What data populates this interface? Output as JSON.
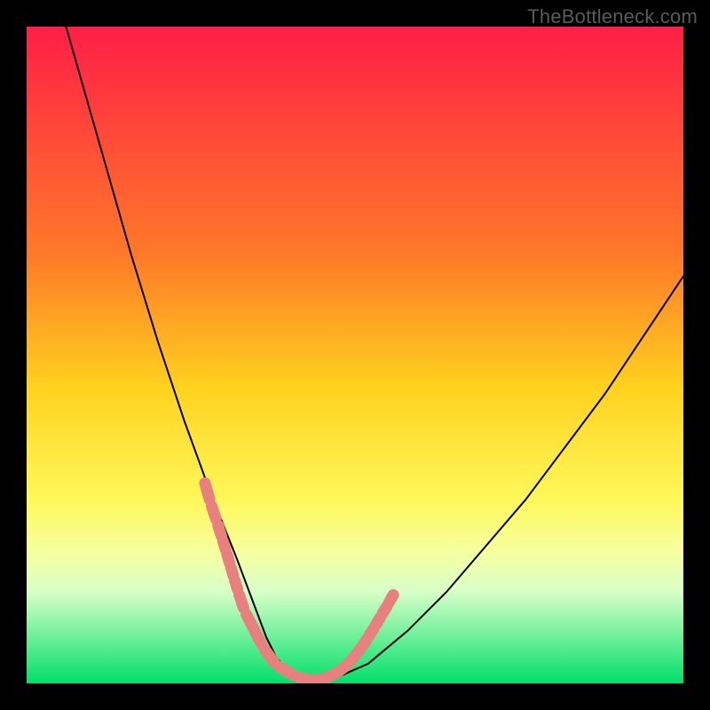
{
  "watermark": "TheBottleneck.com",
  "chart_data": {
    "type": "line",
    "title": "",
    "xlabel": "",
    "ylabel": "",
    "xlim": [
      0,
      100
    ],
    "ylim": [
      0,
      100
    ],
    "grid": false,
    "legend": false,
    "gradient_stops": [
      {
        "offset": 0,
        "color": "#ff1e47"
      },
      {
        "offset": 35,
        "color": "#ff7a28"
      },
      {
        "offset": 55,
        "color": "#ffd21f"
      },
      {
        "offset": 72,
        "color": "#fff85a"
      },
      {
        "offset": 80,
        "color": "#f7ffa0"
      },
      {
        "offset": 86,
        "color": "#d8ffc8"
      },
      {
        "offset": 100,
        "color": "#00e06a"
      }
    ],
    "series": [
      {
        "name": "bottleneck-curve",
        "color": "#000000",
        "width": 2,
        "x": [
          6,
          8,
          10,
          12,
          14,
          16,
          18,
          20,
          22,
          24,
          26,
          28,
          30,
          32,
          33.5,
          35,
          36.5,
          38,
          40,
          43,
          47,
          52,
          58,
          64,
          70,
          76,
          82,
          88,
          94,
          100
        ],
        "y": [
          100,
          93,
          86,
          79,
          72,
          65,
          58.5,
          52,
          46,
          40,
          34.5,
          29,
          24,
          19,
          15,
          11,
          7,
          4,
          1.5,
          0.5,
          0.8,
          3,
          8,
          14,
          21,
          28,
          36,
          44,
          53,
          62
        ]
      }
    ],
    "overlay_segments": {
      "name": "highlighted-beads",
      "color": "#e98080",
      "width": 13,
      "x": [
        27,
        28,
        29,
        29.8,
        30.4,
        31,
        31.6,
        32.2,
        33.2,
        36,
        38,
        41,
        43,
        45,
        46.5,
        47.8,
        49,
        50,
        51,
        52,
        53,
        54,
        55,
        56
      ],
      "y": [
        31,
        27.5,
        24.5,
        22,
        20,
        18,
        16,
        14,
        11,
        5.5,
        2.8,
        1.0,
        0.5,
        0.6,
        1.2,
        2.0,
        3.0,
        4.2,
        5.5,
        7.0,
        8.6,
        10.3,
        12.0,
        13.8
      ]
    }
  }
}
